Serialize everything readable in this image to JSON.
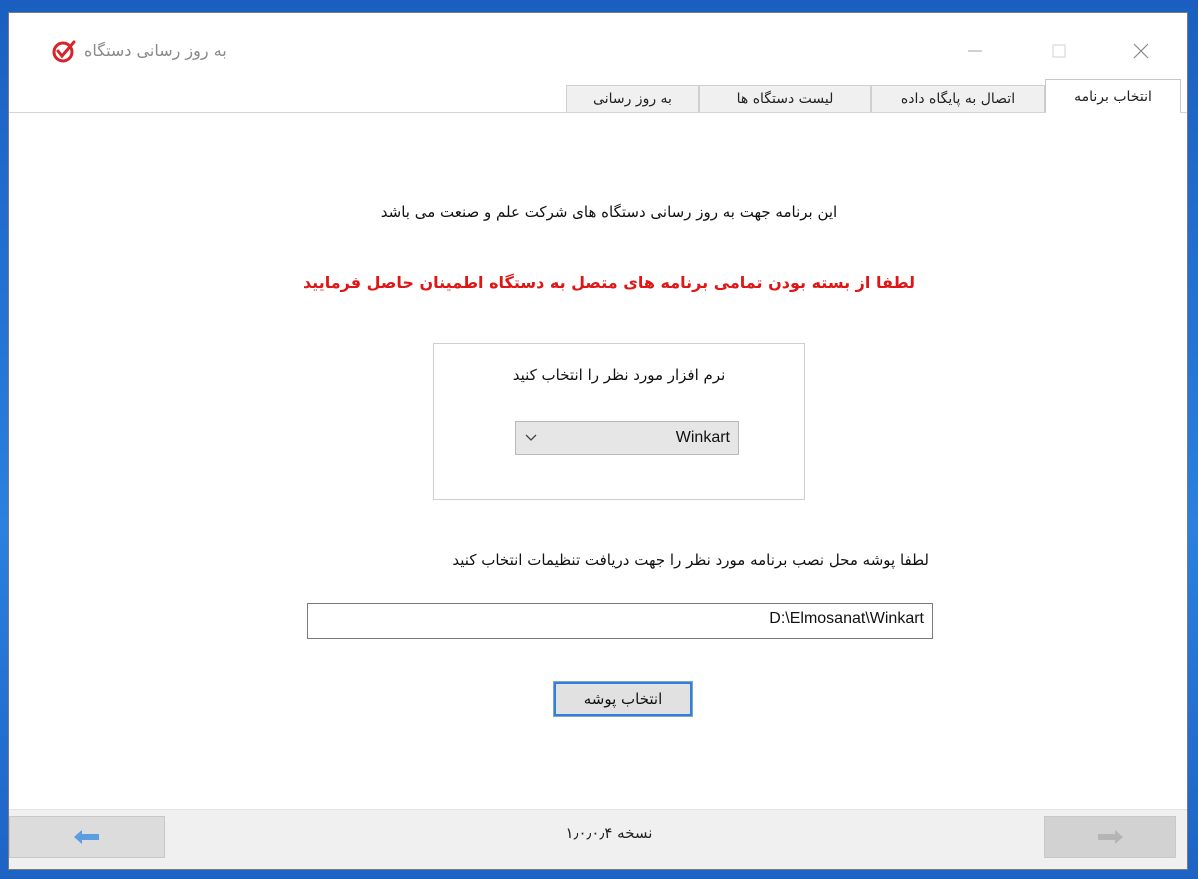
{
  "window": {
    "title": "به روز رسانی دستگاه",
    "accent_color": "#d8232a"
  },
  "tabs": [
    {
      "label": "انتخاب برنامه",
      "active": true
    },
    {
      "label": "اتصال به پایگاه داده",
      "active": false
    },
    {
      "label": "لیست دستگاه ها",
      "active": false
    },
    {
      "label": "به روز رسانی",
      "active": false
    }
  ],
  "main": {
    "intro_text": "این برنامه جهت به روز رسانی  دستگاه های شرکت علم و صنعت می باشد",
    "warning_text": "لطفا از بسته بودن تمامی برنامه های متصل به دستگاه اطمینان حاصل فرمایید",
    "warning_color": "#e01515",
    "software_group": {
      "label": "نرم افزار مورد نظر را انتخاب کنید",
      "selected": "Winkart"
    },
    "folder_label": "لطفا پوشه محل نصب برنامه مورد نظر را جهت دریافت تنظیمات انتخاب کنید",
    "folder_path": "D:\\Elmosanat\\Winkart",
    "choose_folder_button": "انتخاب پوشه"
  },
  "footer": {
    "version": "نسخه ۱٫۰٫۰٫۴",
    "back_icon": "arrow-left-icon",
    "next_icon": "arrow-right-icon"
  }
}
